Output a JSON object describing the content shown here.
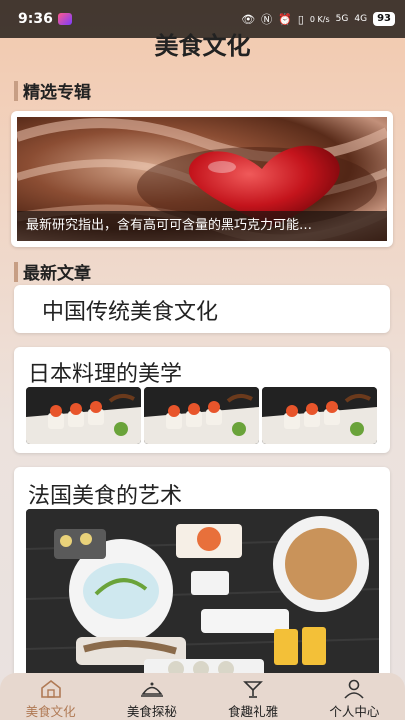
{
  "status": {
    "time": "9:36",
    "network": "5G",
    "network2": "4G",
    "speed": "0 K/s",
    "battery": "93"
  },
  "header": {
    "title": "美食文化"
  },
  "featured": {
    "heading": "精选专辑",
    "caption": "最新研究指出，含有高可可含量的黑巧克力可能…"
  },
  "latest": {
    "heading": "最新文章",
    "articles": [
      {
        "title": "中国传统美食文化"
      },
      {
        "title": "日本料理的美学"
      },
      {
        "title": "法国美食的艺术"
      }
    ]
  },
  "tabs": [
    {
      "label": "美食文化",
      "icon": "home-icon",
      "active": true
    },
    {
      "label": "美食探秘",
      "icon": "dish-cover-icon",
      "active": false
    },
    {
      "label": "食趣礼雅",
      "icon": "cocktail-glass-icon",
      "active": false
    },
    {
      "label": "个人中心",
      "icon": "person-icon",
      "active": false
    }
  ],
  "colors": {
    "accent": "#b07a55",
    "section_bar": "#c79e84",
    "status_bar": "#000000"
  }
}
